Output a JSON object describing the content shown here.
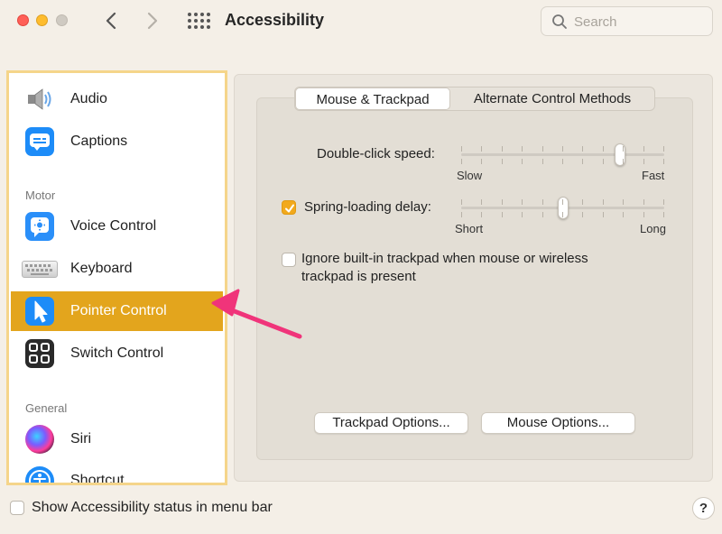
{
  "window": {
    "title": "Accessibility",
    "search_placeholder": "Search"
  },
  "sidebar": {
    "items": [
      {
        "label": "Audio",
        "icon": "speaker-icon"
      },
      {
        "label": "Captions",
        "icon": "captions-icon"
      },
      {
        "header": "Motor"
      },
      {
        "label": "Voice Control",
        "icon": "voice-control-icon"
      },
      {
        "label": "Keyboard",
        "icon": "keyboard-icon"
      },
      {
        "label": "Pointer Control",
        "icon": "pointer-icon",
        "selected": true
      },
      {
        "label": "Switch Control",
        "icon": "switch-control-icon"
      },
      {
        "header": "General"
      },
      {
        "label": "Siri",
        "icon": "siri-icon"
      },
      {
        "label": "Shortcut",
        "icon": "shortcut-icon"
      }
    ]
  },
  "tabs": [
    {
      "label": "Mouse & Trackpad",
      "active": true
    },
    {
      "label": "Alternate Control Methods",
      "active": false
    }
  ],
  "settings": {
    "double_click": {
      "label": "Double-click speed:",
      "min_label": "Slow",
      "max_label": "Fast",
      "level": 0.8
    },
    "spring_loading": {
      "label": "Spring-loading delay:",
      "checked": true,
      "min_label": "Short",
      "max_label": "Long",
      "level": 0.5
    },
    "ignore_trackpad": {
      "label_line1": "Ignore built-in trackpad when mouse or wireless",
      "label_line2": "trackpad is present",
      "checked": false
    }
  },
  "buttons": {
    "trackpad_options": "Trackpad Options...",
    "mouse_options": "Mouse Options..."
  },
  "footer": {
    "status_label": "Show Accessibility status in menu bar",
    "status_checked": false,
    "help": "?"
  },
  "colors": {
    "selection": "#e3a51d",
    "checkbox_accent": "#f2a91c",
    "annotation_arrow": "#f0347a",
    "sidebar_highlight_border": "#f5d58a"
  }
}
